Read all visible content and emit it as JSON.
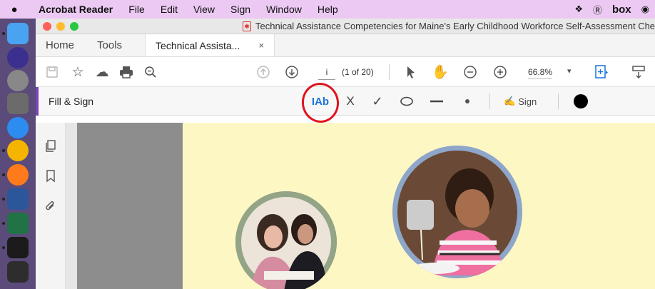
{
  "menubar": {
    "apple_icon": "apple-icon",
    "app_name": "Acrobat Reader",
    "items": [
      "File",
      "Edit",
      "View",
      "Sign",
      "Window",
      "Help"
    ],
    "status_box": "box"
  },
  "window": {
    "title": "Technical Assistance Competencies for Maine's Early Childhood Workforce Self-Assessment Chec"
  },
  "tabs": {
    "home": "Home",
    "tools": "Tools",
    "document": "Technical Assista...",
    "close": "×"
  },
  "toolbar": {
    "page_input": "i",
    "page_count": "(1 of 20)",
    "zoom": "66.8%"
  },
  "fill_sign": {
    "label": "Fill & Sign",
    "text_tool": "IAb",
    "cross": "X",
    "check": "✓",
    "sign": "Sign"
  },
  "colors": {
    "menubar": "#ebc9f2",
    "accent": "#7a43b6",
    "highlight": "#e0141c",
    "page_bg": "#fdf7c4"
  }
}
